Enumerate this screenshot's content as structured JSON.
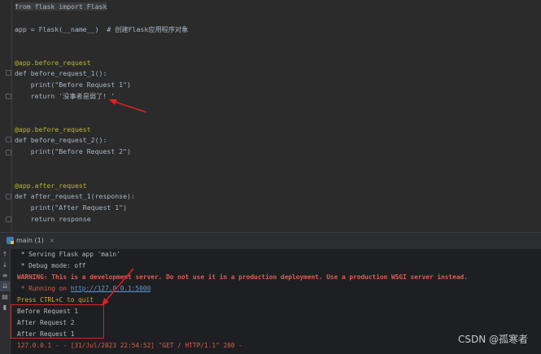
{
  "editor": {
    "lines": [
      "from flask import Flask",
      "app = Flask(__name__)  # 创建Flask应用程序对象",
      "@app.before_request",
      "def before_request_1():",
      "    print(\"Before Request 1\")",
      "    return '没事者是弱了! '",
      "@app.before_request",
      "def before_request_2():",
      "    print(\"Before Request 2\")",
      "@app.after_request",
      "def after_request_1(response):",
      "    print(\"After Request 1\")",
      "    return response"
    ]
  },
  "run_panel": {
    "tab_label": "main (1)",
    "close_glyph": "×"
  },
  "console": {
    "serving": " * Serving Flask app 'main'",
    "debug": " * Debug mode: off",
    "warning": "WARNING: This is a development server. Do not use it in a production deployment. Use a production WSGI server instead.",
    "running_prefix": " * Running on ",
    "running_url": "http://127.0.0.1:5000",
    "ctrl_c": "Press CTRL+C to quit",
    "out1": "Before Request 1",
    "out2": "After Request 2",
    "out3": "After Request 1",
    "log": "127.0.0.1 - - [31/Jul/2023 22:54:52] \"GET / HTTP/1.1\" 200 -"
  },
  "watermark": "CSDN @孤寒者",
  "colors": {
    "annotation": "#e02020"
  }
}
